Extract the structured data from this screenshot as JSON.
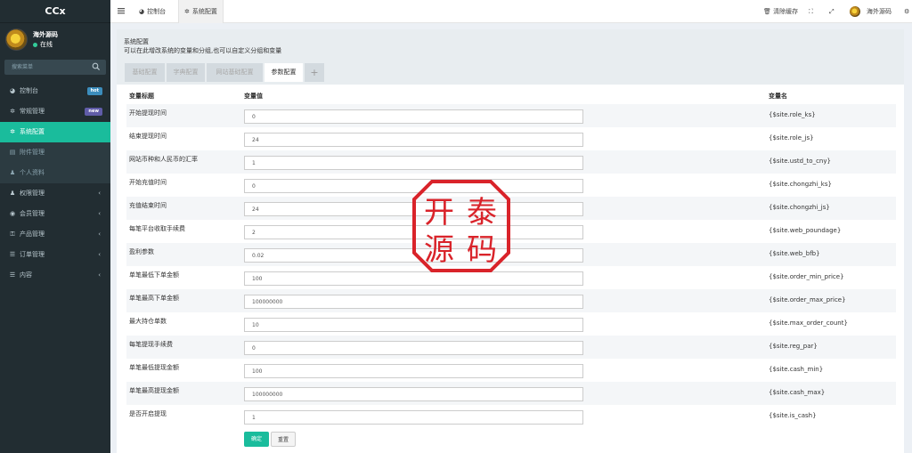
{
  "app": {
    "brand": "CCx"
  },
  "user": {
    "name": "海外源码",
    "status": "在线"
  },
  "search": {
    "placeholder": "搜索菜单"
  },
  "sidebar": {
    "items": [
      {
        "label": "控制台",
        "icon": "dashboard-icon",
        "badge": "hot",
        "badge_color": "#3c8dbc"
      },
      {
        "label": "常规管理",
        "icon": "cogs-icon",
        "badge": "new",
        "badge_color": "#605ca8"
      },
      {
        "label": "系统配置",
        "icon": "gear-icon",
        "active": true
      },
      {
        "label": "附件管理",
        "icon": "file-icon",
        "sub": true
      },
      {
        "label": "个人资料",
        "icon": "user-icon",
        "sub": true
      },
      {
        "label": "权限管理",
        "icon": "group-icon",
        "arrow": "‹"
      },
      {
        "label": "会员管理",
        "icon": "user-circle-icon",
        "arrow": "‹"
      },
      {
        "label": "产品管理",
        "icon": "key-icon",
        "arrow": "‹"
      },
      {
        "label": "订单管理",
        "icon": "list-icon",
        "arrow": "‹"
      },
      {
        "label": "内容",
        "icon": "list-icon",
        "arrow": "‹"
      }
    ]
  },
  "topbar": {
    "tabs": [
      {
        "label": "控制台",
        "icon": "dashboard-icon"
      },
      {
        "label": "系统配置",
        "icon": "gear-icon",
        "active": true
      }
    ],
    "clear_cache": "清除缓存",
    "user_name": "海外源码"
  },
  "panel": {
    "title": "系统配置",
    "subtitle": "可以在此增改系统的变量和分组,也可以自定义分组和变量",
    "tabs": [
      "基础配置",
      "字典配置",
      "网站基础配置",
      "参数配置",
      "+"
    ],
    "active_tab": 3
  },
  "table": {
    "headers": {
      "title": "变量标题",
      "value": "变量值",
      "name": "变量名"
    },
    "rows": [
      {
        "label": "开始提现时间",
        "value": "0",
        "var": "{$site.role_ks}"
      },
      {
        "label": "结束提现时间",
        "value": "24",
        "var": "{$site.role_js}"
      },
      {
        "label": "网站币种和人民币的汇率",
        "value": "1",
        "var": "{$site.ustd_to_cny}"
      },
      {
        "label": "开始充值时间",
        "value": "0",
        "var": "{$site.chongzhi_ks}"
      },
      {
        "label": "充值结束时间",
        "value": "24",
        "var": "{$site.chongzhi_js}"
      },
      {
        "label": "每笔平台收取手续费",
        "value": "2",
        "var": "{$site.web_poundage}"
      },
      {
        "label": "盈利参数",
        "value": "0.02",
        "var": "{$site.web_bfb}"
      },
      {
        "label": "单笔最低下单金额",
        "value": "100",
        "var": "{$site.order_min_price}"
      },
      {
        "label": "单笔最高下单金额",
        "value": "100000000",
        "var": "{$site.order_max_price}"
      },
      {
        "label": "最大持仓单数",
        "value": "10",
        "var": "{$site.max_order_count}"
      },
      {
        "label": "每笔提现手续费",
        "value": "0",
        "var": "{$site.reg_par}"
      },
      {
        "label": "单笔最低提现金额",
        "value": "100",
        "var": "{$site.cash_min}"
      },
      {
        "label": "单笔最高提现金额",
        "value": "100000000",
        "var": "{$site.cash_max}"
      },
      {
        "label": "是否开启提现",
        "value": "1",
        "var": "{$site.is_cash}"
      }
    ]
  },
  "buttons": {
    "submit": "确定",
    "reset": "重置"
  },
  "watermark": {
    "chars": [
      "开",
      "泰",
      "源",
      "码"
    ],
    "color": "#d9232a"
  },
  "colors": {
    "accent": "#1abc9c",
    "sidebar_bg": "#222d32"
  }
}
